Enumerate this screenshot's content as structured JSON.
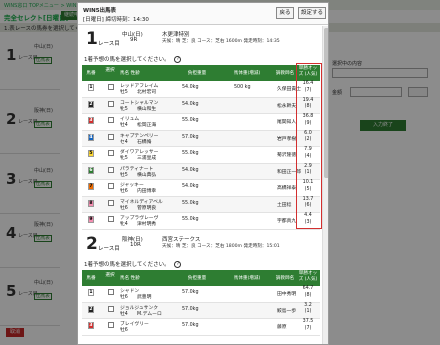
{
  "background": {
    "breadcrumb": "WINS窓口  TOPメニュー > WINS出馬表 > ...",
    "page_title": "完全セレクト[日曜日]",
    "title_button": "継続申込",
    "notice": "1.表レースの馬券を選択してください。",
    "races": [
      {
        "num": "1",
        "label": "レース目",
        "venue": "中山(日)",
        "button": "出馬表"
      },
      {
        "num": "2",
        "label": "レース目",
        "venue": "阪神(日)",
        "button": "出馬表"
      },
      {
        "num": "3",
        "label": "レース目",
        "venue": "中山(日)",
        "button": "出馬表"
      },
      {
        "num": "4",
        "label": "レース目",
        "venue": "阪神(日)",
        "button": "出馬表"
      },
      {
        "num": "5",
        "label": "レース目",
        "venue": "中山(日)",
        "button": "出馬表"
      }
    ],
    "side_label": "選択中の内容",
    "money_label": "金額",
    "money_unit": "00円",
    "add_button": "入力終了",
    "clear_button": "取消"
  },
  "modal": {
    "title": "WIN5出馬表",
    "subtitle": "[日曜日]  締切時刻：14:30",
    "back_button": "戻る",
    "set_button": "設定する",
    "races": [
      {
        "num": "1",
        "label": "レース目",
        "venue": "中山(日)",
        "race_no": "9R",
        "name": "木更津特別",
        "info": "天候：晴  芝：良  コース：芝右 1600m  発走時刻：14:35",
        "instruction": "1着予想の馬を選択してください。",
        "headers": {
          "gate": "馬番",
          "select": "選択",
          "name": "馬名 性齢",
          "jockey": "騎手名",
          "weight": "負担重量",
          "bw": "馬体重(増減)",
          "trainer": "調教師名",
          "odds": "単勝オッズ (人気)"
        },
        "horses": [
          {
            "gate": "1",
            "gate_color": "#ffffff",
            "name": "レッドアフレイム",
            "sex_age": "牡5",
            "jockey": "北村宏司",
            "weight": "54.0kg",
            "bw": "500 kg",
            "trainer": "久保田貴士",
            "odds": "16.4",
            "pop": "(7)"
          },
          {
            "gate": "2",
            "gate_color": "#222222",
            "name": "コートシャルマン",
            "sex_age": "牝5",
            "jockey": "横山和生",
            "weight": "54.0kg",
            "bw": "",
            "trainer": "松永幹夫",
            "odds": "19.4",
            "pop": "(8)"
          },
          {
            "gate": "3",
            "gate_color": "#d32f2f",
            "name": "イリュム",
            "sex_age": "牡4",
            "jockey": "松岡正海",
            "weight": "55.0kg",
            "bw": "",
            "trainer": "尾関知人",
            "odds": "36.8",
            "pop": "(9)"
          },
          {
            "gate": "4",
            "gate_color": "#1565c0",
            "name": "キャプテンペリー",
            "sex_age": "セ4",
            "jockey": "石橋脩",
            "weight": "57.0kg",
            "bw": "",
            "trainer": "岩戸孝樹",
            "odds": "6.0",
            "pop": "(2)"
          },
          {
            "gate": "5",
            "gate_color": "#fdd835",
            "name": "ダイワアレッサー",
            "sex_age": "牝5",
            "jockey": "三浦皇成",
            "weight": "55.0kg",
            "bw": "",
            "trainer": "菊沢隆徳",
            "odds": "7.9",
            "pop": "(4)"
          },
          {
            "gate": "6",
            "gate_color": "#2e7d32",
            "name": "パラティナート",
            "sex_age": "牡5",
            "jockey": "横山典弘",
            "weight": "54.0kg",
            "bw": "",
            "trainer": "和田正一郎",
            "odds": "2.9",
            "pop": "(1)"
          },
          {
            "gate": "7",
            "gate_color": "#ef6c00",
            "name": "ジャッキー",
            "sex_age": "牡6",
            "jockey": "内田博幸",
            "weight": "54.0kg",
            "bw": "",
            "trainer": "高橋祥泰",
            "odds": "10.1",
            "pop": "(5)"
          },
          {
            "gate": "8",
            "gate_color": "#f48fb1",
            "name": "マイネルディアベル",
            "sex_age": "牡6",
            "jockey": "菅原明良",
            "weight": "55.0kg",
            "bw": "",
            "trainer": "土田稔",
            "odds": "13.7",
            "pop": "(6)"
          },
          {
            "gate": "9",
            "gate_color": "#f48fb1",
            "name": "アップラヴレーヴ",
            "sex_age": "牝4",
            "jockey": "津村明秀",
            "weight": "55.0kg",
            "bw": "",
            "trainer": "宇都真九",
            "odds": "4.4",
            "pop": "(3)"
          }
        ]
      },
      {
        "num": "2",
        "label": "レース目",
        "venue": "阪神(日)",
        "race_no": "10R",
        "name": "西宮ステークス",
        "info": "天候：晴  芝：良  コース：芝右 1800m  発走時刻：15:01",
        "instruction": "1着予想の馬を選択してください。",
        "horses": [
          {
            "gate": "1",
            "gate_color": "#ffffff",
            "name": "シャドン",
            "sex_age": "牡6",
            "jockey": "武豊明",
            "weight": "57.0kg",
            "bw": "",
            "trainer": "田中秀明",
            "odds": "64.7",
            "pop": "(8)"
          },
          {
            "gate": "2",
            "gate_color": "#222222",
            "name": "ジョルジュサンク",
            "sex_age": "牡4",
            "jockey": "M.デムーロ",
            "weight": "57.0kg",
            "bw": "",
            "trainer": "鮫島一歩",
            "odds": "3.2",
            "pop": "(1)"
          },
          {
            "gate": "3",
            "gate_color": "#d32f2f",
            "name": "ブレイヴリー",
            "sex_age": "牡6",
            "jockey": "",
            "weight": "57.0kg",
            "bw": "",
            "trainer": "藤原",
            "odds": "37.5",
            "pop": "(7)"
          }
        ]
      }
    ]
  }
}
